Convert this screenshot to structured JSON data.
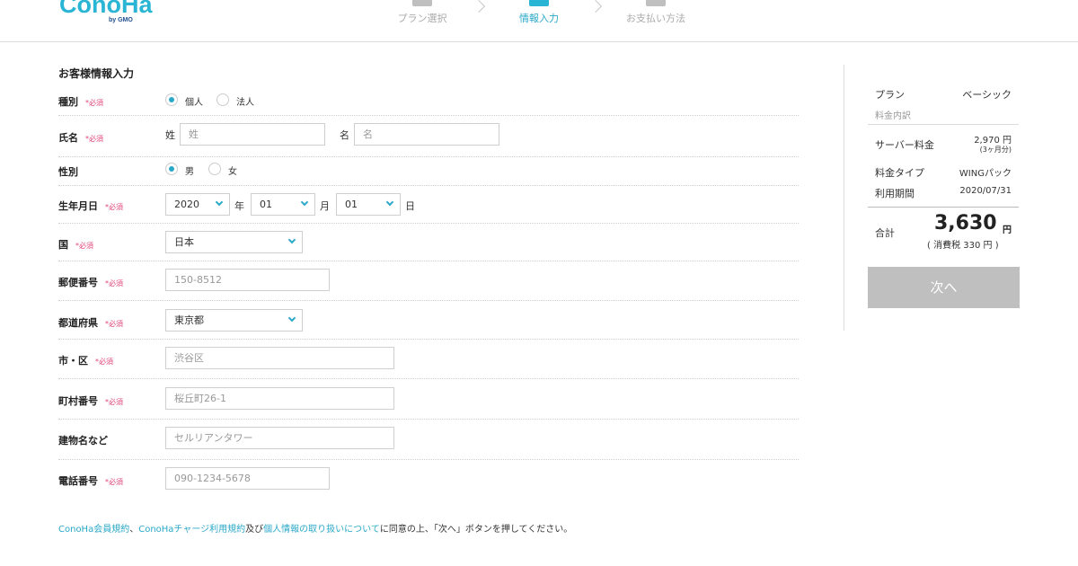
{
  "header": {
    "logo_text": "ConoHa",
    "logo_sub": "by GMO",
    "steps": [
      {
        "label": "プラン選択",
        "active": false
      },
      {
        "label": "情報入力",
        "active": true
      },
      {
        "label": "お支払い方法",
        "active": false
      }
    ]
  },
  "form": {
    "title": "お客様情報入力",
    "required_text": "*必須",
    "type": {
      "label": "種別",
      "options": [
        "個人",
        "法人"
      ],
      "selected": "個人"
    },
    "name": {
      "label": "氏名",
      "last_label": "姓",
      "last_placeholder": "姓",
      "first_label": "名",
      "first_placeholder": "名"
    },
    "gender": {
      "label": "性別",
      "options": [
        "男",
        "女"
      ],
      "selected": "男"
    },
    "birth": {
      "label": "生年月日",
      "year": "2020",
      "year_unit": "年",
      "month": "01",
      "month_unit": "月",
      "day": "01",
      "day_unit": "日"
    },
    "country": {
      "label": "国",
      "value": "日本"
    },
    "postal": {
      "label": "郵便番号",
      "placeholder": "150-8512"
    },
    "prefecture": {
      "label": "都道府県",
      "value": "東京都"
    },
    "city": {
      "label": "市・区",
      "placeholder": "渋谷区"
    },
    "town": {
      "label": "町村番号",
      "placeholder": "桜丘町26-1"
    },
    "building": {
      "label": "建物名など",
      "placeholder": "セルリアンタワー"
    },
    "phone": {
      "label": "電話番号",
      "placeholder": "090-1234-5678"
    }
  },
  "agreement": {
    "link1": "ConoHa会員規約",
    "sep1": "、",
    "link2": "ConoHaチャージ利用規約",
    "sep2": "及び",
    "link3": "個人情報の取り扱いについて",
    "rest": "に同意の上、「次へ」ボタンを押してください。"
  },
  "summary": {
    "plan_label": "プラン",
    "plan_value": "ベーシック",
    "breakdown_label": "料金内訳",
    "server_fee_label": "サーバー料金",
    "server_fee_value": "2,970 円",
    "server_fee_note": "(3ヶ月分)",
    "fee_type_label": "料金タイプ",
    "fee_type_value": "WINGパック",
    "period_label": "利用期間",
    "period_value": "2020/07/31",
    "total_label": "合計",
    "total_value": "3,630",
    "total_unit": "円",
    "tax_note": "( 消費税 330 円 )",
    "next_button": "次へ"
  },
  "colors": {
    "accent": "#2aa8c8",
    "required": "#e0457a",
    "button_disabled": "#bfbfbf"
  }
}
